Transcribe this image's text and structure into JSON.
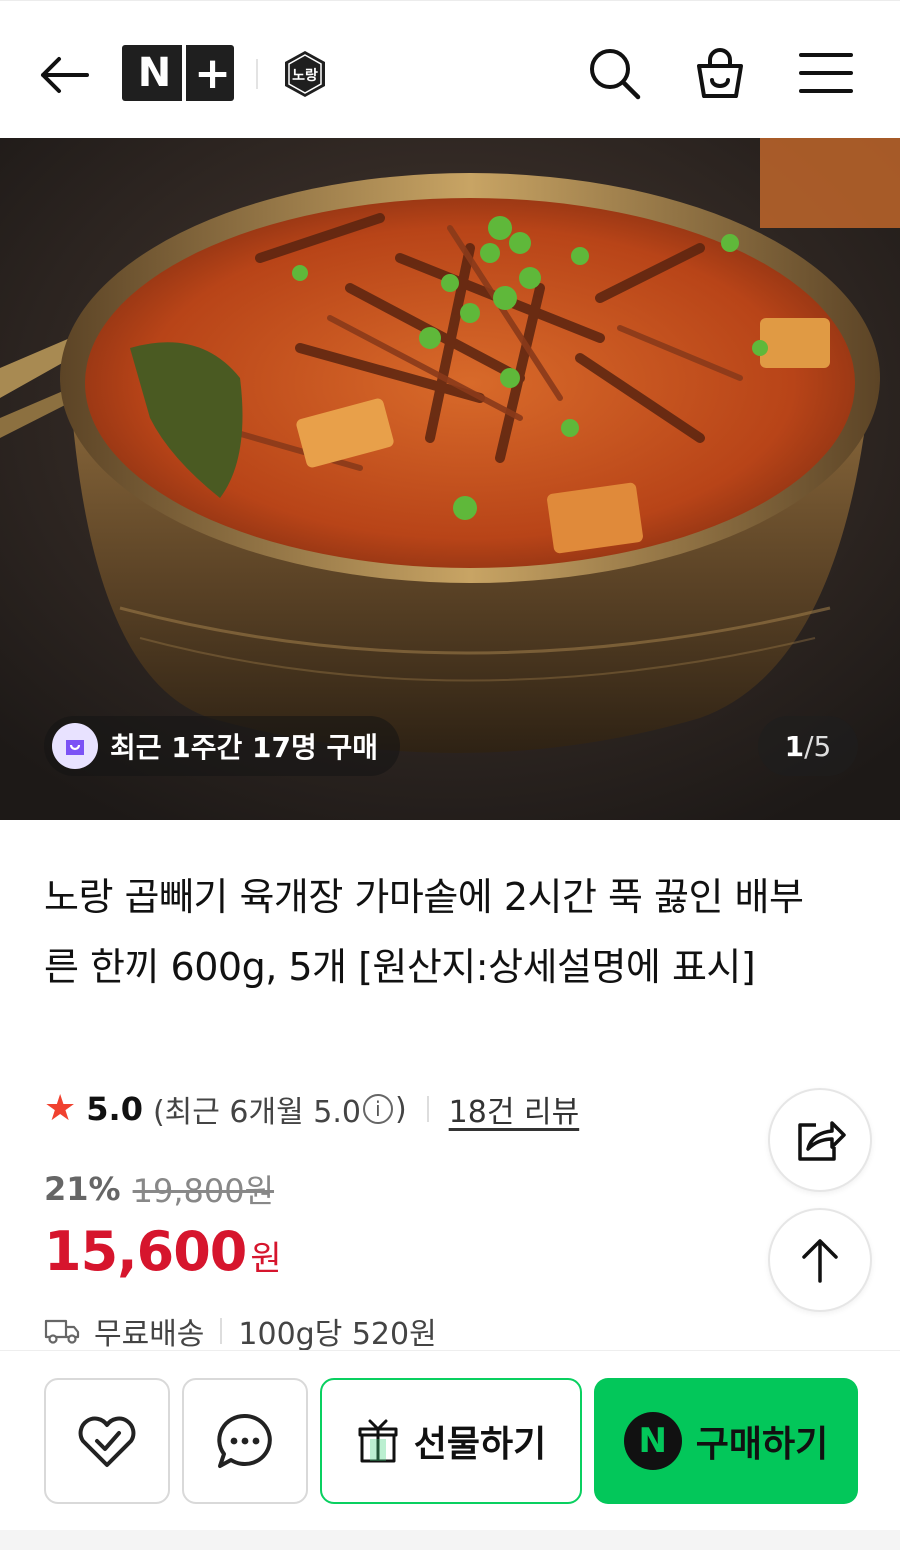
{
  "header": {
    "back_icon": "arrow-left-icon",
    "store_logo_n": "N",
    "store_logo_plus": "+",
    "brand_logo_text": "노랑",
    "search_icon": "search-icon",
    "cart_icon": "shopping-bag-icon",
    "menu_icon": "hamburger-menu-icon"
  },
  "hero": {
    "recent_purchase": "최근 1주간 17명 구매",
    "page_current": "1",
    "page_total": "/5"
  },
  "product": {
    "title": "노랑 곱빼기 육개장 가마솥에 2시간 푹 끓인 배부른 한끼 600g, 5개 [원산지:상세설명에 표시]",
    "rating": "5.0",
    "rating_recent_prefix": "(최근 6개월 5.0",
    "rating_recent_suffix": ")",
    "info_symbol": "i",
    "review_link": "18건 리뷰",
    "discount_rate": "21%",
    "original_price": "19,800원",
    "price": "15,600",
    "price_unit": "원",
    "shipping": "무료배송",
    "unit_price": "100g당 520원"
  },
  "actions": {
    "gift_label": "선물하기",
    "buy_label": "구매하기",
    "buy_badge": "N"
  },
  "colors": {
    "price_red": "#d6152d",
    "naver_green": "#03c75a",
    "star_red": "#f0412f"
  }
}
